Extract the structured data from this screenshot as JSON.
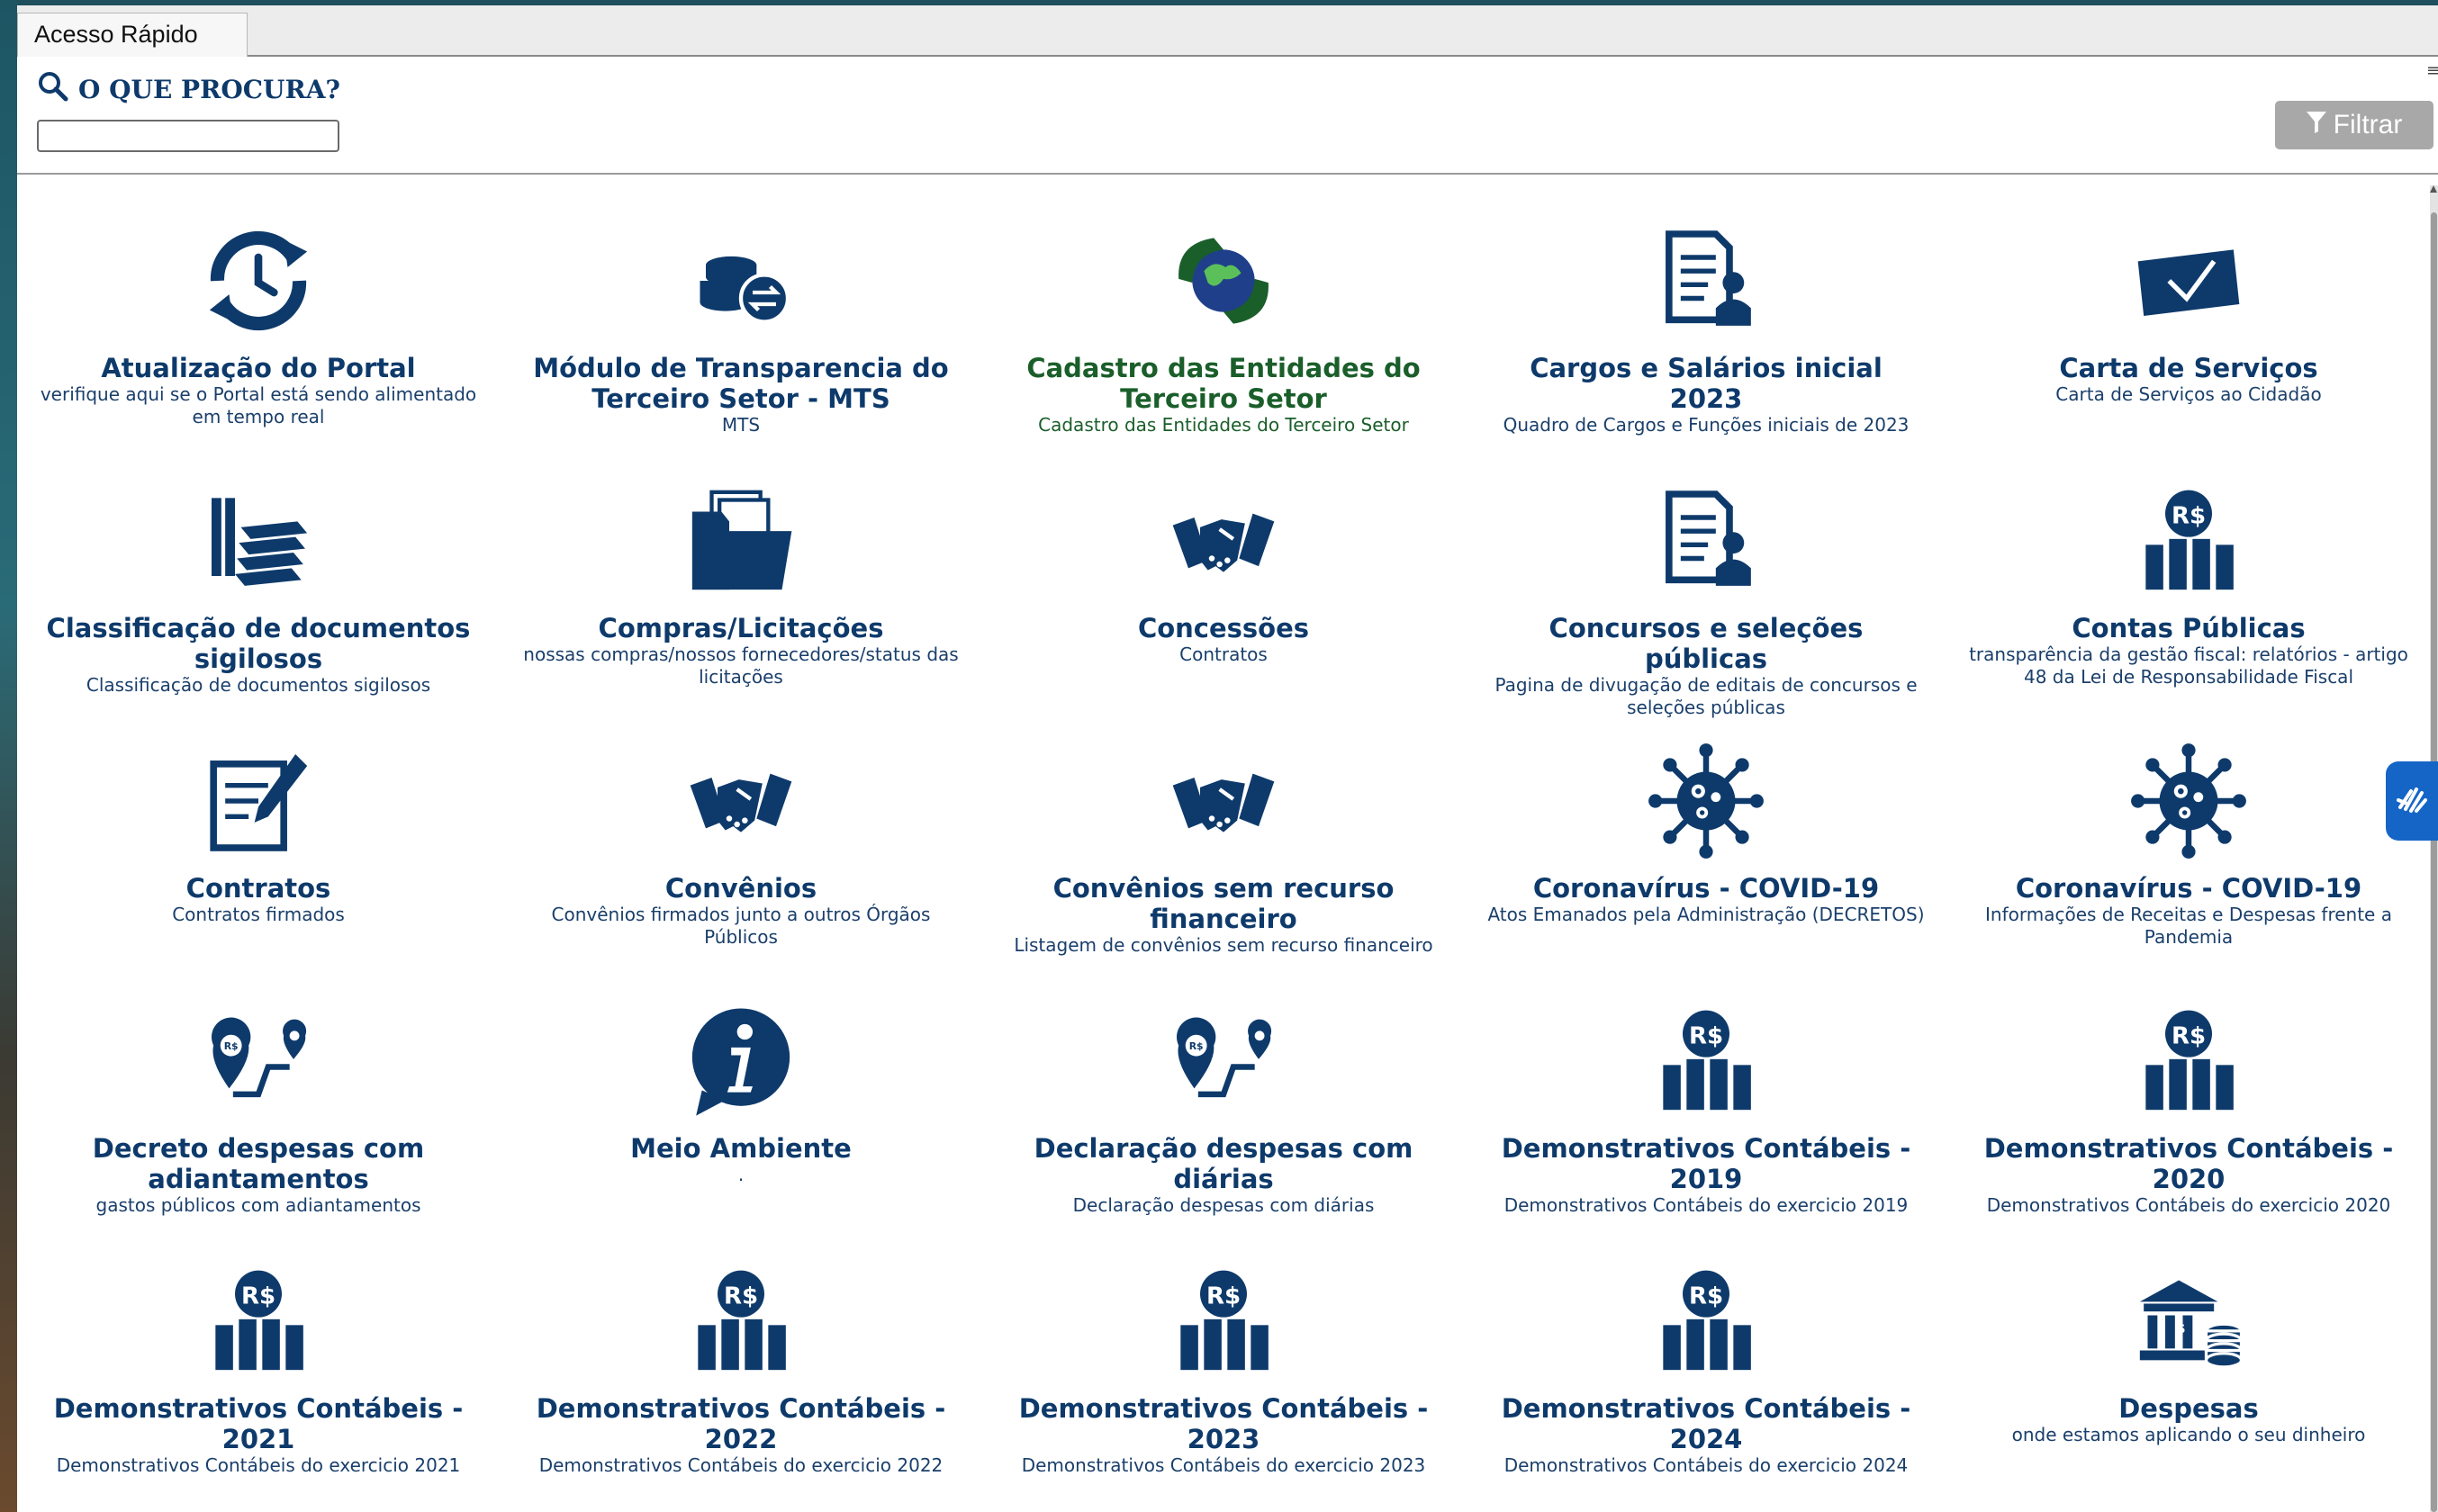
{
  "window": {
    "tab_label": "Acesso Rápido"
  },
  "search": {
    "label": "O QUE PROCURA?",
    "value": "",
    "placeholder": ""
  },
  "filter": {
    "label": "Filtrar"
  },
  "colors": {
    "primary": "#0e3a6b",
    "green": "#1a5e2a",
    "filter_bg": "#a8a8a8",
    "accessibility": "#1565c7"
  },
  "tiles": [
    {
      "title": "Atualização do Portal",
      "subtitle": "verifique aqui se o Portal está sendo alimentado em tempo real",
      "icon": "clock-refresh-icon"
    },
    {
      "title": "Módulo de Transparencia do Terceiro Setor - MTS",
      "subtitle": "MTS",
      "icon": "coins-exchange-icon"
    },
    {
      "title": "Cadastro das Entidades do Terceiro Setor",
      "subtitle": "Cadastro das Entidades do Terceiro Setor",
      "icon": "globe-hands-icon",
      "color": "green"
    },
    {
      "title": "Cargos e Salários inicial 2023",
      "subtitle": "Quadro de Cargos e Funções iniciais de 2023",
      "icon": "document-person-icon"
    },
    {
      "title": "Carta de Serviços",
      "subtitle": "Carta de Serviços ao Cidadão",
      "icon": "envelope-check-icon"
    },
    {
      "title": "Classificação de documentos sigilosos",
      "subtitle": "Classificação de documentos sigilosos",
      "icon": "document-stack-icon"
    },
    {
      "title": "Compras/Licitações",
      "subtitle": "nossas compras/nossos fornecedores/status das licitações",
      "icon": "folder-documents-icon"
    },
    {
      "title": "Concessões",
      "subtitle": "Contratos",
      "icon": "handshake-icon"
    },
    {
      "title": "Concursos e seleções públicas",
      "subtitle": "Pagina de divugação de editais de concursos e seleções públicas",
      "icon": "document-person-icon"
    },
    {
      "title": "Contas Públicas",
      "subtitle": "transparência da gestão fiscal: relatórios - artigo 48 da Lei de Responsabilidade Fiscal",
      "icon": "money-chart-icon"
    },
    {
      "title": "Contratos",
      "subtitle": "Contratos firmados",
      "icon": "contract-pen-icon"
    },
    {
      "title": "Convênios",
      "subtitle": "Convênios firmados junto a outros Órgãos Públicos",
      "icon": "handshake-icon"
    },
    {
      "title": "Convênios sem recurso financeiro",
      "subtitle": "Listagem de convênios sem recurso financeiro",
      "icon": "handshake-icon"
    },
    {
      "title": "Coronavírus - COVID-19",
      "subtitle": "Atos Emanados pela Administração (DECRETOS)",
      "icon": "virus-icon"
    },
    {
      "title": "Coronavírus - COVID-19",
      "subtitle": "Informações de Receitas e Despesas frente a Pandemia",
      "icon": "virus-icon"
    },
    {
      "title": "Decreto despesas com adiantamentos",
      "subtitle": "gastos públicos com adiantamentos",
      "icon": "route-money-icon"
    },
    {
      "title": "Meio Ambiente",
      "subtitle": ".",
      "icon": "info-bubble-icon"
    },
    {
      "title": "Declaração despesas com diárias",
      "subtitle": "Declaração despesas com diárias",
      "icon": "route-money-icon"
    },
    {
      "title": "Demonstrativos Contábeis - 2019",
      "subtitle": "Demonstrativos Contábeis do exercicio 2019",
      "icon": "money-chart-icon"
    },
    {
      "title": "Demonstrativos Contábeis - 2020",
      "subtitle": "Demonstrativos Contábeis do exercicio 2020",
      "icon": "money-chart-icon"
    },
    {
      "title": "Demonstrativos Contábeis - 2021",
      "subtitle": "Demonstrativos Contábeis do exercicio 2021",
      "icon": "money-chart-icon"
    },
    {
      "title": "Demonstrativos Contábeis - 2022",
      "subtitle": "Demonstrativos Contábeis do exercicio 2022",
      "icon": "money-chart-icon"
    },
    {
      "title": "Demonstrativos Contábeis - 2023",
      "subtitle": "Demonstrativos Contábeis do exercicio 2023",
      "icon": "money-chart-icon"
    },
    {
      "title": "Demonstrativos Contábeis - 2024",
      "subtitle": "Demonstrativos Contábeis do exercicio 2024",
      "icon": "money-chart-icon"
    },
    {
      "title": "Despesas",
      "subtitle": "onde estamos aplicando o seu dinheiro",
      "icon": "bank-coins-icon"
    }
  ]
}
